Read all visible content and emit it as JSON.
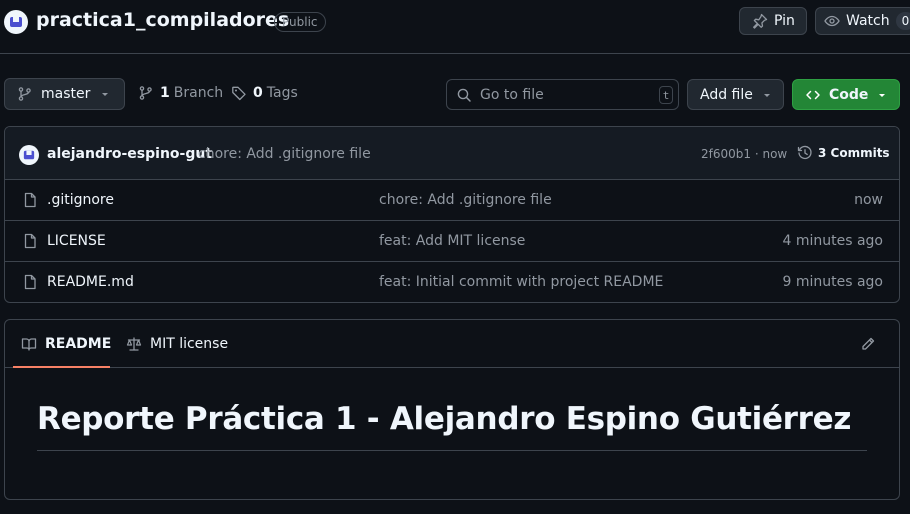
{
  "repo": {
    "name": "practica1_compiladores",
    "visibility": "Public"
  },
  "actions": {
    "pin_label": "Pin",
    "watch_label": "Watch",
    "watch_count": "0"
  },
  "toolbar": {
    "branch": "master",
    "branch_count": "1",
    "branch_label": "Branch",
    "tag_count": "0",
    "tag_label": "Tags",
    "search_placeholder": "Go to file",
    "search_shortcut": "t",
    "add_file_label": "Add file",
    "code_label": "Code"
  },
  "latest_commit": {
    "author": "alejandro-espino-gut",
    "message": "chore: Add .gitignore file",
    "hash_time": "2f600b1 · now",
    "commits_label": "3 Commits"
  },
  "files": [
    {
      "name": ".gitignore",
      "message": "chore: Add .gitignore file",
      "time": "now"
    },
    {
      "name": "LICENSE",
      "message": "feat: Add MIT license",
      "time": "4 minutes ago"
    },
    {
      "name": "README.md",
      "message": "feat: Initial commit with project README",
      "time": "9 minutes ago"
    }
  ],
  "readme": {
    "tabs": [
      "README",
      "MIT license"
    ],
    "heading": "Reporte Práctica 1 - Alejandro Espino Gutiérrez"
  },
  "colors": {
    "background": "#0d1117",
    "accent_green": "#238636",
    "tab_underline": "#f78166"
  },
  "icons": [
    "repo-avatar-icon",
    "pin-icon",
    "eye-icon",
    "branch-icon",
    "tag-icon",
    "search-icon",
    "code-icon",
    "history-icon",
    "file-icon",
    "book-icon",
    "scale-icon",
    "pencil-icon",
    "triangle-down-icon"
  ]
}
